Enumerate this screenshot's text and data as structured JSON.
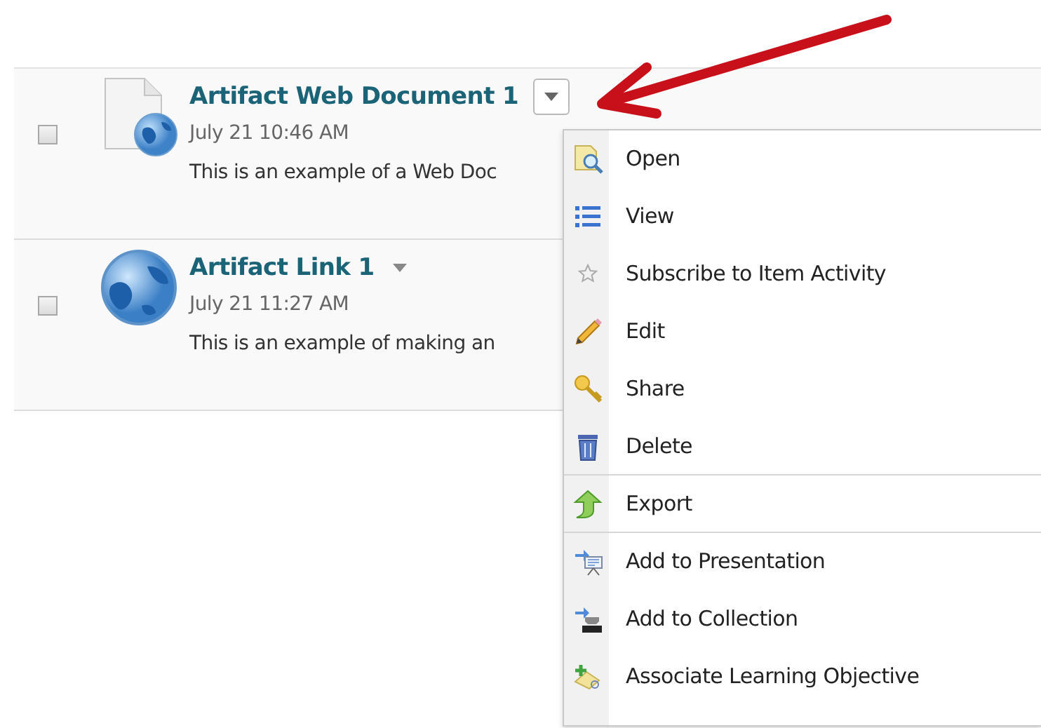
{
  "items": [
    {
      "kind": "document",
      "title": "Artifact Web Document 1",
      "checked": false,
      "date": "July 21 10:46 AM",
      "description": "This is an example of a Web Doc",
      "menu_open": true
    },
    {
      "kind": "link",
      "title": "Artifact Link 1",
      "checked": false,
      "date": "July 21 11:27 AM",
      "description": "This is an example of making an",
      "menu_open": false
    }
  ],
  "menu": {
    "groups": [
      [
        {
          "kind": "open",
          "label": "Open"
        },
        {
          "kind": "view",
          "label": "View"
        },
        {
          "kind": "subscribe",
          "label": "Subscribe to Item Activity"
        },
        {
          "kind": "edit",
          "label": "Edit"
        },
        {
          "kind": "share",
          "label": "Share"
        },
        {
          "kind": "delete",
          "label": "Delete"
        }
      ],
      [
        {
          "kind": "export",
          "label": "Export"
        }
      ],
      [
        {
          "kind": "presentation",
          "label": "Add to Presentation"
        },
        {
          "kind": "collection",
          "label": "Add to Collection"
        },
        {
          "kind": "objective",
          "label": "Associate Learning Objective"
        }
      ]
    ]
  }
}
